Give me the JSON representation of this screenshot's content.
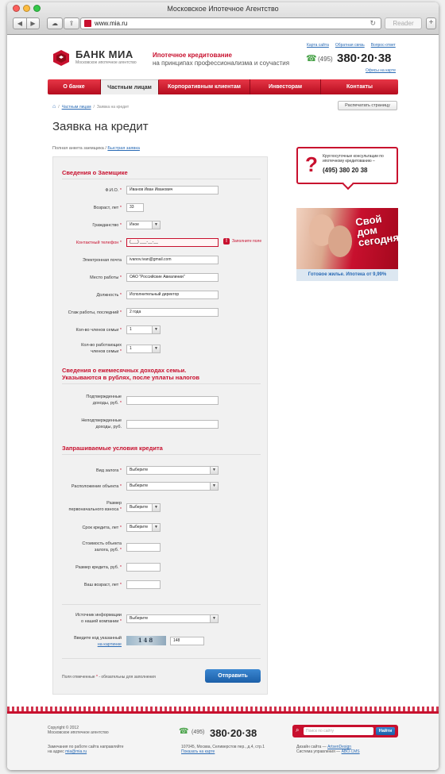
{
  "browser": {
    "window_title": "Московское Ипотечное Агентство",
    "url": "www.mia.ru",
    "reader_label": "Reader"
  },
  "header": {
    "logo_name": "БАНК МИА",
    "logo_sub": "Московское ипотечное агентство",
    "slogan_title": "Ипотечное кредитование",
    "slogan_text": "на принципах профессионализма и соучастия",
    "links": [
      "Карта сайта",
      "Обратная связь",
      "Вопрос-ответ"
    ],
    "phone_code": "(495)",
    "phone_number": "380·20·38",
    "offices_link": "Офисы на карте"
  },
  "menu": [
    "О банке",
    "Частным лицам",
    "Корпоративным клиентам",
    "Инвесторам",
    "Контакты"
  ],
  "breadcrumb": {
    "sep": "/",
    "items": [
      "Частным лицам",
      "Заявка на кредит"
    ]
  },
  "print_label": "Распечатать страницу",
  "page_title": "Заявка на кредит",
  "form_tabs": {
    "full": "Полная анкета заемщика",
    "sep": "/",
    "quick": "Быстрая заявка"
  },
  "sections": {
    "borrower": "Сведения о Заемщике",
    "income_1": "Сведения о ежемесячных доходах семьи.",
    "income_2": "Указываются в рублях, после уплаты налогов",
    "conditions": "Запрашиваемые условия кредита"
  },
  "fields": {
    "fio": {
      "label": "Ф.И.О.",
      "value": "Иванов Иван Иванович"
    },
    "age": {
      "label": "Возраст, лет",
      "value": "33"
    },
    "citizenship": {
      "label": "Гражданство",
      "value": "Иное"
    },
    "phone": {
      "label": "Контактный телефон",
      "value": "(___) ___-__-__",
      "error": "Заполните поле"
    },
    "email": {
      "label": "Электронная почта",
      "value": "ivanov.ivan@gmail.com"
    },
    "workplace": {
      "label": "Место работы",
      "value": "ОАО \"Российские Авиалинии\""
    },
    "position": {
      "label": "Должность",
      "value": "Исполнительный директор"
    },
    "experience": {
      "label": "Стаж работы, последний",
      "value": "2 года"
    },
    "family": {
      "label": "Кол-во членов семьи",
      "value": "1"
    },
    "working_1": {
      "label": "Кол-во работающих",
      "value": "1"
    },
    "working_2": {
      "label": "членов семьи"
    },
    "confirmed_1": {
      "label": "Подтвержденные"
    },
    "confirmed_2": {
      "label": "доходы, руб."
    },
    "unconfirmed_1": {
      "label": "Неподтвержденные"
    },
    "unconfirmed_2": {
      "label": "доходы, руб."
    },
    "collateral": {
      "label": "Вид залога",
      "value": "Выберите"
    },
    "location": {
      "label": "Расположение объекта",
      "value": "Выберите"
    },
    "downpay_1": {
      "label": "Размер"
    },
    "downpay_2": {
      "label": "первоначального взноса",
      "value": "Выберите"
    },
    "term": {
      "label": "Срок кредита, лет",
      "value": "Выберите"
    },
    "cost_1": {
      "label": "Стоимость объекта"
    },
    "cost_2": {
      "label": "залога, руб."
    },
    "amount": {
      "label": "Размер кредита, руб."
    },
    "your_age": {
      "label": "Ваш возраст, лет"
    },
    "source_1": {
      "label": "Источник информации"
    },
    "source_2": {
      "label": "о нашей компании",
      "value": "Выберите"
    },
    "captcha_1": {
      "label": "Введите код указанный"
    },
    "captcha_2": {
      "label": "на картинке",
      "image_text": "148",
      "value": "148"
    }
  },
  "required_star": "*",
  "required_note": "Поля отмеченные",
  "required_note_tail": "- обязательны для заполнения",
  "submit_label": "Отправить",
  "sidebar": {
    "consult_text": "Круглосуточные консультации по ипотечному кредитованию –",
    "consult_phone": "(495) 380 20 38",
    "banner_text": "Свой дом сегодня!",
    "banner_caption": "Готовое жилье. Ипотека от 9,99%"
  },
  "footer": {
    "copyright": "Copyright © 2012",
    "company": "Московское ипотечное агентство",
    "feedback": "Замечания по работе сайта направляйте",
    "email_prefix": "на адрес",
    "email": "mia@mia.ru",
    "phone_code": "(495)",
    "phone_number": "380·20·38",
    "address": "107045, Москва, Селиверстов пер., д.4, стр.1",
    "map_link": "Показать на карте",
    "design_prefix": "Дизайн сайта —",
    "design_link": "ArtsenDesign",
    "cms_prefix": "Система управления —",
    "cms_link": "ABO.CMS",
    "search_placeholder": "Поиск по сайту",
    "search_button": "Найти"
  },
  "colors": {
    "accent": "#c8102e",
    "link": "#2a6bb5",
    "button": "#1b5fa8",
    "phone_icon": "#4aa34a"
  }
}
